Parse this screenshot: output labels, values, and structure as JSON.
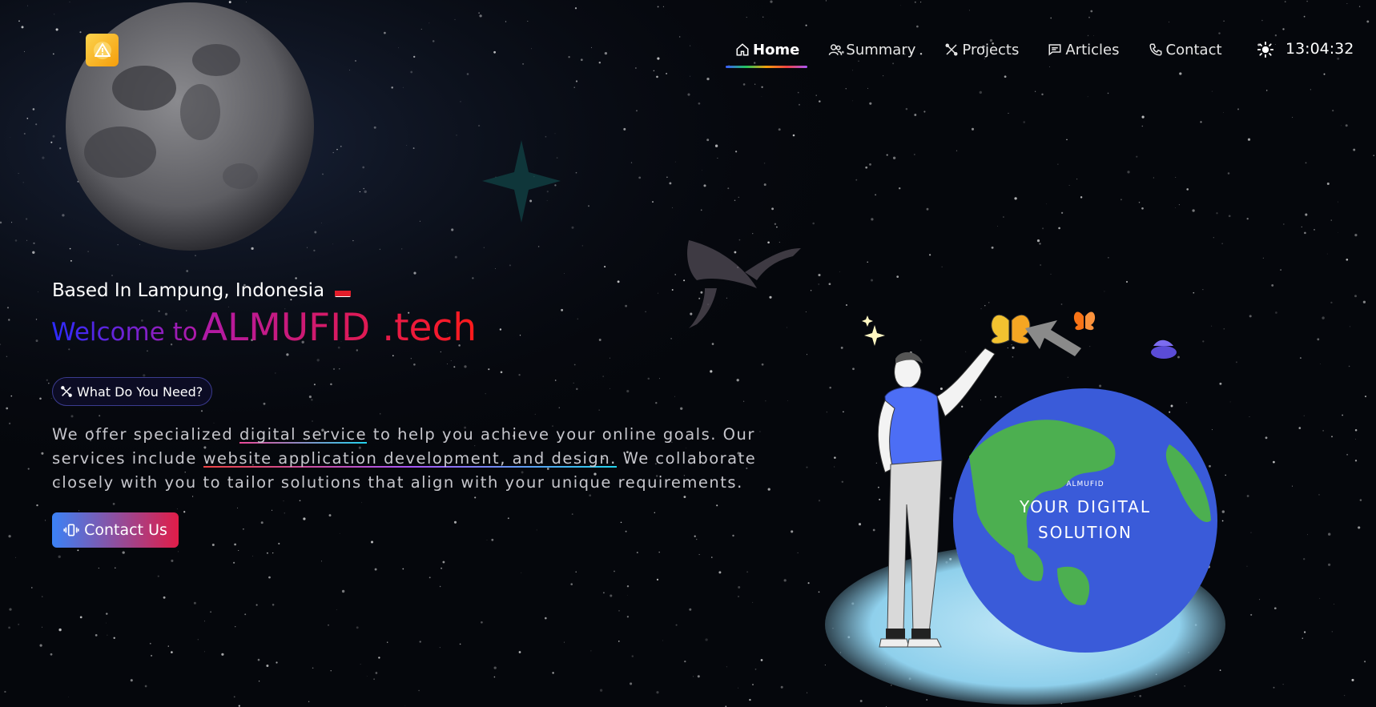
{
  "header": {
    "clock": "13:04:32",
    "theme_icon": "sun-icon",
    "logo_icon": "warning-triangle-icon",
    "nav": [
      {
        "label": "Home",
        "icon": "home-icon",
        "active": true
      },
      {
        "label": "Summary",
        "icon": "users-icon",
        "active": false
      },
      {
        "label": "Projects",
        "icon": "tools-icon",
        "active": false
      },
      {
        "label": "Articles",
        "icon": "message-icon",
        "active": false
      },
      {
        "label": "Contact",
        "icon": "phone-icon",
        "active": false
      }
    ]
  },
  "hero": {
    "location": "Based In Lampung, Indonesia",
    "welcome_prefix": "Welcome to",
    "brand": "ALMUFID .tech",
    "need_button": "What Do You Need?",
    "desc_part1": "We offer specialized ",
    "desc_link1": "digital service",
    "desc_part2": " to help you achieve your online goals. Our services include ",
    "desc_link2": "website application development, and design.",
    "desc_part3": " We collaborate closely with you to tailor solutions that align with your unique requirements.",
    "cta_label": "Contact Us"
  },
  "globe": {
    "small_label": "ALMUFID",
    "line1": "YOUR DIGITAL",
    "line2": "SOLUTION"
  },
  "colors": {
    "brand_blue": "#2b2bff",
    "brand_magenta": "#b01aa8",
    "brand_red": "#ff1a1a",
    "globe_blue": "#3a5bd9",
    "globe_green": "#4caf50"
  }
}
